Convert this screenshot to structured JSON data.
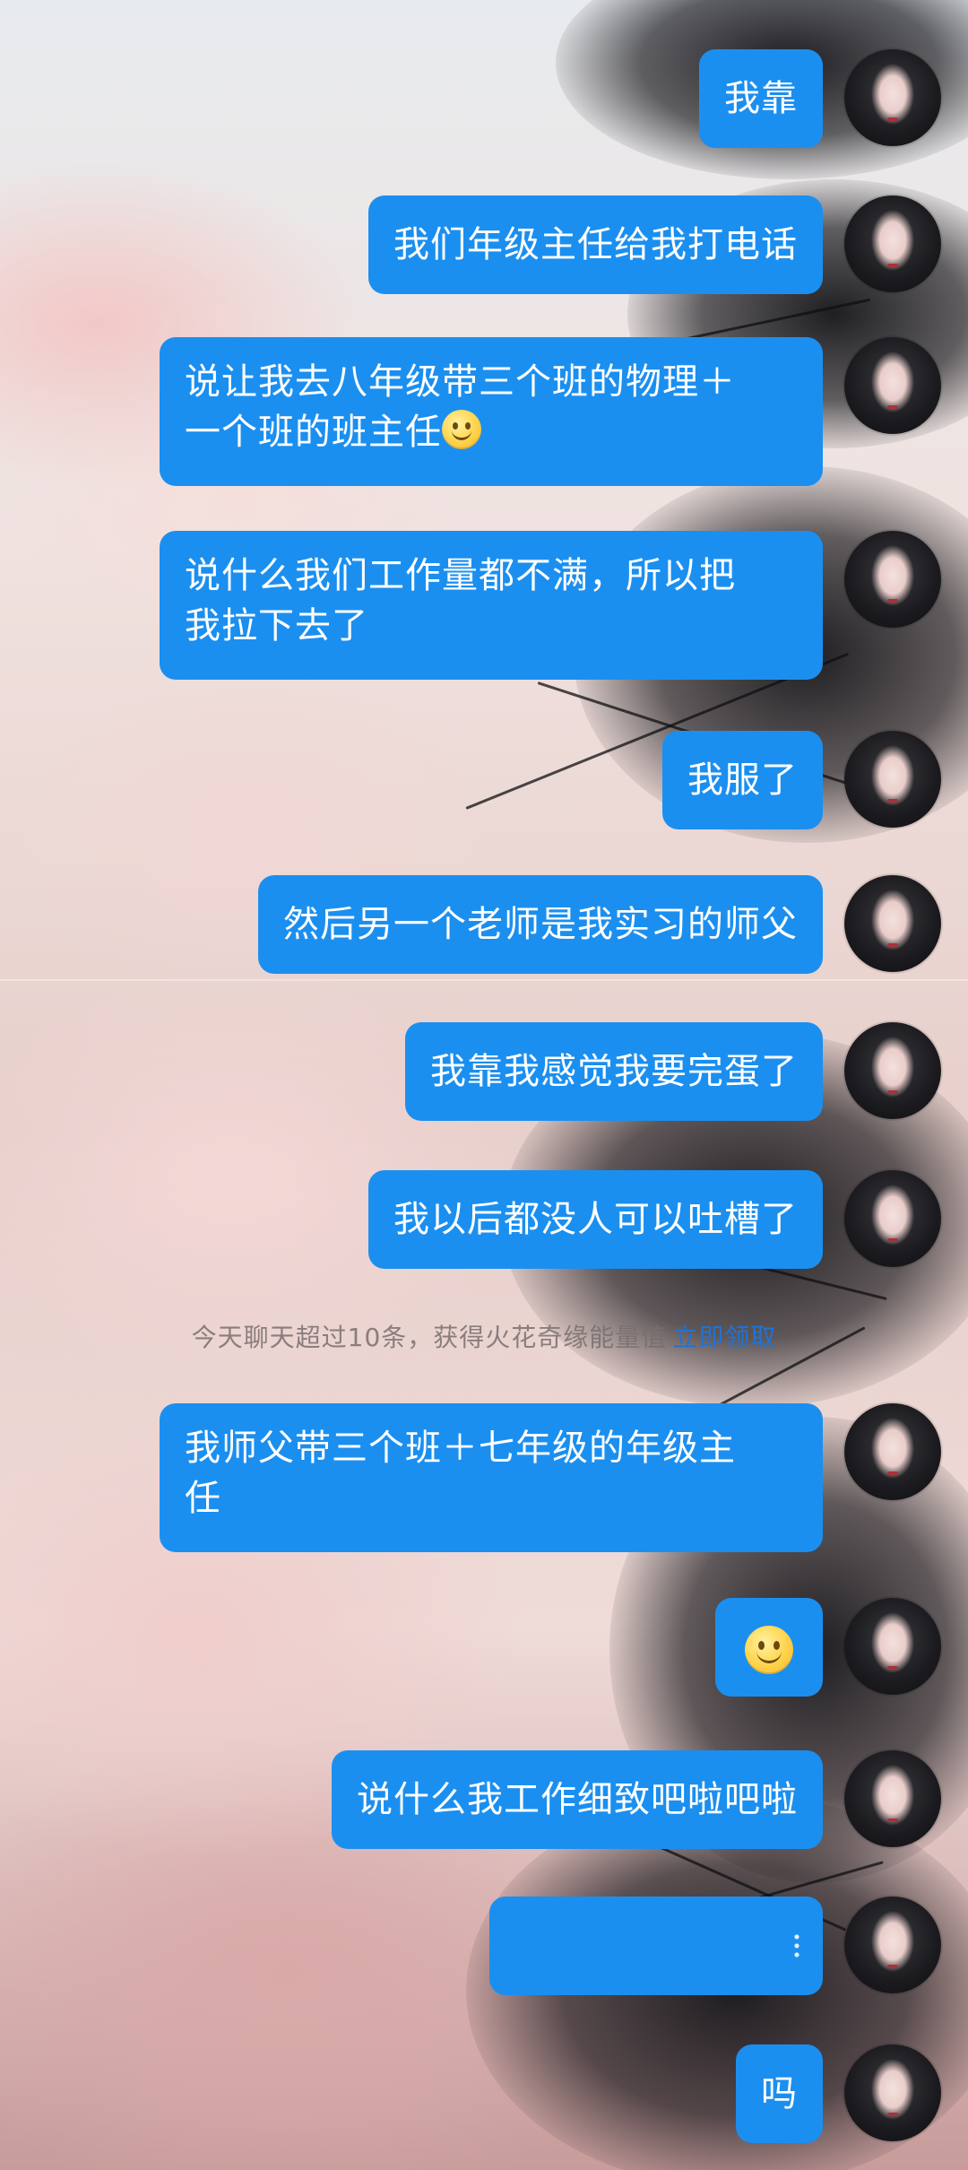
{
  "messages": [
    {
      "text": "我靠"
    },
    {
      "text": "我们年级主任给我打电话"
    },
    {
      "text": "说让我去八年级带三个班的物理＋",
      "text2": "一个班的班主任",
      "emoji": "smile-emoji"
    },
    {
      "text": "说什么我们工作量都不满，所以把",
      "text2": "我拉下去了"
    },
    {
      "text": "我服了"
    },
    {
      "text": "然后另一个老师是我实习的师父"
    },
    {
      "text": "我靠我感觉我要完蛋了"
    },
    {
      "text": "我以后都没人可以吐槽了"
    },
    {
      "text": "我师父带三个班＋七年级的年级主",
      "text2": "任"
    },
    {
      "emoji": "smile-emoji"
    },
    {
      "text": "说什么我工作细致吧啦吧啦"
    },
    {
      "text": ""
    },
    {
      "text": "吗"
    }
  ],
  "system_notice": {
    "text": "今天聊天超过10条，获得火花奇缘能量值",
    "link": "立即领取"
  },
  "colors": {
    "bubble": "#1b8ff0",
    "bubble_text": "#ffffff",
    "link": "#1e73d9"
  }
}
